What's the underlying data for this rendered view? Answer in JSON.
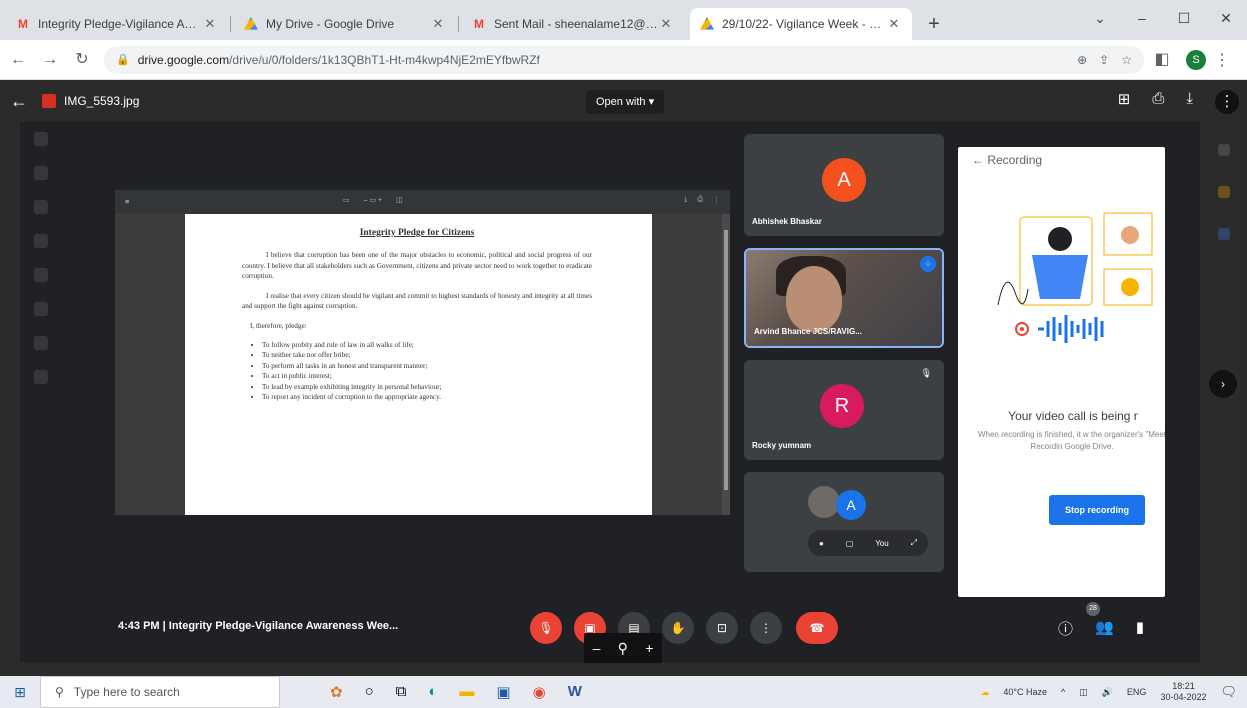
{
  "browser": {
    "tabs": [
      {
        "title": "Integrity Pledge-Vigilance Awar",
        "icon": "gmail-icon",
        "active": false
      },
      {
        "title": "My Drive - Google Drive",
        "icon": "drive-icon",
        "active": false
      },
      {
        "title": "Sent Mail - sheenalame12@gm",
        "icon": "gmail-icon",
        "active": false
      },
      {
        "title": "29/10/22- Vigilance Week - Goo",
        "icon": "drive-icon",
        "active": true
      }
    ],
    "url_host": "drive.google.com",
    "url_path": "/drive/u/0/folders/1k13QBhT1-Ht-m4kwp4NjE2mEYfbwRZf"
  },
  "viewer": {
    "filename": "IMG_5593.jpg",
    "open_with": "Open with ▾"
  },
  "meet": {
    "document": {
      "title": "Integrity Pledge for Citizens",
      "para1": "I believe that corruption has been one of the major obstacles to economic, political and social progress of our country. I believe that all stakeholders such as Government, citizens and private sector need to work together to eradicate corruption.",
      "para2": "I realise that every citizen should be vigilant and commit to highest standards of honesty and integrity at all times and support the fight against corruption.",
      "para3": "I, therefore, pledge:",
      "bullets": [
        "To follow probity and rule of law in all walks of life;",
        "To neither take nor offer bribe;",
        "To perform all tasks in an honest and transparent manner;",
        "To act in public interest;",
        "To lead by example exhibiting integrity in personal behaviour;",
        "To report any incident of corruption to the appropriate agency."
      ]
    },
    "participants": [
      {
        "initial": "A",
        "name": "Abhishek Bhaskar",
        "color": "#f4511e"
      },
      {
        "initial": "",
        "name": "Arvind Bhance JCS/RAVIG...",
        "color": ""
      },
      {
        "initial": "R",
        "name": "Rocky yumnam",
        "color": "#d81b60"
      },
      {
        "initial": "A",
        "name": "You",
        "color": "#1a73e8"
      }
    ],
    "recording": {
      "header": "Recording",
      "message": "Your video call is being r",
      "sub": "When recording is finished, it w the organizer's \"Meet Recordin Google Drive.",
      "stop": "Stop recording"
    },
    "bar": {
      "time_title": "4:43 PM  |  Integrity Pledge-Vigilance Awareness Wee...",
      "people_count": "28"
    }
  },
  "taskbar": {
    "search_placeholder": "Type here to search",
    "weather": "40°C Haze",
    "lang": "ENG",
    "time": "18:21",
    "date": "30-04-2022"
  }
}
